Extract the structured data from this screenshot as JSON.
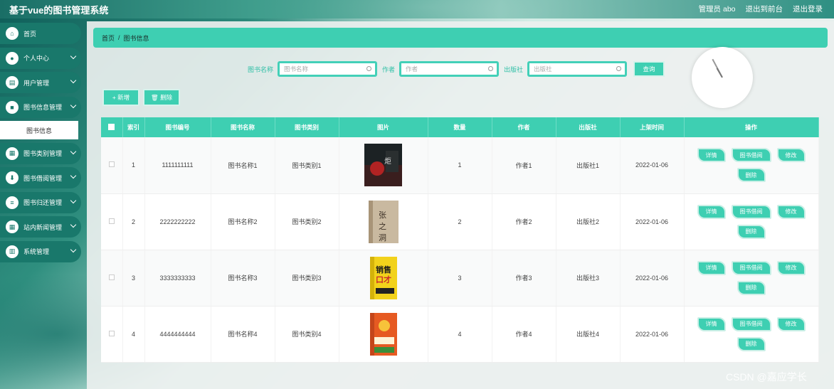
{
  "app_title": "基于vue的图书管理系统",
  "topbar": {
    "admin": "管理员 abo",
    "back": "退出到前台",
    "logout": "退出登录"
  },
  "sidebar": {
    "items": [
      {
        "label": "首页",
        "icon": "home-icon",
        "glyph": "⌂"
      },
      {
        "label": "个人中心",
        "icon": "user-icon",
        "glyph": "●"
      },
      {
        "label": "用户管理",
        "icon": "users-icon",
        "glyph": "▤"
      },
      {
        "label": "图书信息管理",
        "icon": "book-icon",
        "glyph": "■"
      },
      {
        "label": "图书类别管理",
        "icon": "category-icon",
        "glyph": "▦"
      },
      {
        "label": "图书借阅管理",
        "icon": "borrow-icon",
        "glyph": "⬇"
      },
      {
        "label": "图书归还管理",
        "icon": "return-icon",
        "glyph": "≡"
      },
      {
        "label": "站内新闻管理",
        "icon": "news-icon",
        "glyph": "▦"
      },
      {
        "label": "系统管理",
        "icon": "settings-icon",
        "glyph": "▥"
      }
    ],
    "sub_item": "图书信息"
  },
  "breadcrumb": {
    "home": "首页",
    "sep": "/",
    "current": "图书信息"
  },
  "search": {
    "name_label": "图书名称",
    "name_placeholder": "图书名称",
    "author_label": "作者",
    "author_placeholder": "作者",
    "publisher_label": "出版社",
    "publisher_placeholder": "出版社",
    "query": "查询"
  },
  "actions": {
    "add": "+ 新增",
    "delete": "🗑 删除"
  },
  "table": {
    "headers": [
      "索引",
      "图书编号",
      "图书名称",
      "图书类别",
      "图片",
      "数量",
      "作者",
      "出版社",
      "上架时间",
      "操作"
    ],
    "rows": [
      {
        "idx": "1",
        "code": "1111111111",
        "name": "图书名称1",
        "cat": "图书类别1",
        "qty": "1",
        "author": "作者1",
        "pub": "出版社1",
        "date": "2022-01-06"
      },
      {
        "idx": "2",
        "code": "2222222222",
        "name": "图书名称2",
        "cat": "图书类别2",
        "qty": "2",
        "author": "作者2",
        "pub": "出版社2",
        "date": "2022-01-06"
      },
      {
        "idx": "3",
        "code": "3333333333",
        "name": "图书名称3",
        "cat": "图书类别3",
        "qty": "3",
        "author": "作者3",
        "pub": "出版社3",
        "date": "2022-01-06"
      },
      {
        "idx": "4",
        "code": "4444444444",
        "name": "图书名称4",
        "cat": "图书类别4",
        "qty": "4",
        "author": "作者4",
        "pub": "出版社4",
        "date": "2022-01-06"
      }
    ],
    "ops": {
      "detail": "详情",
      "borrow": "图书借阅",
      "edit": "修改",
      "del": "删除"
    }
  },
  "watermark": "CSDN @嘉应学长",
  "colors": {
    "accent": "#3ecfb2",
    "sidebar": "#19786b"
  }
}
